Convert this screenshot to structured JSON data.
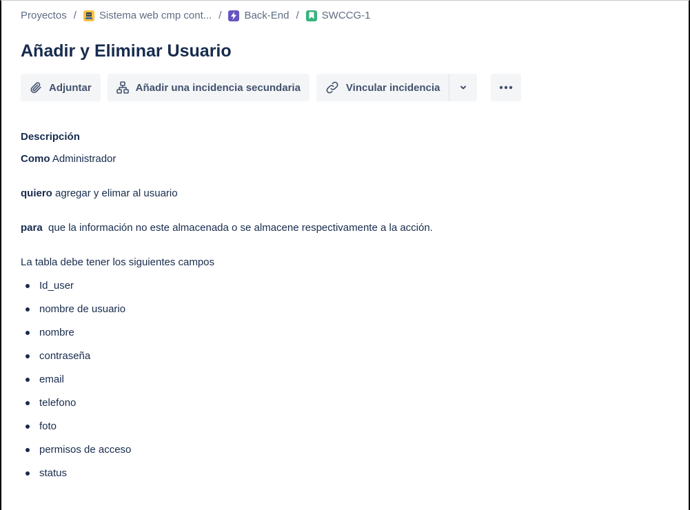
{
  "breadcrumb": {
    "projects": "Proyectos",
    "separator": "/",
    "project": "Sistema web cmp cont...",
    "epic": "Back-End",
    "issue_key": "SWCCG-1"
  },
  "issue": {
    "title": "Añadir y Eliminar Usuario"
  },
  "toolbar": {
    "attach": "Adjuntar",
    "add_child": "Añadir una incidencia secundaria",
    "link_issue": "Vincular incidencia",
    "icons": {
      "attach": "paperclip-icon",
      "add_child": "hierarchy-icon",
      "link_issue": "link-icon",
      "dropdown": "chevron-down-icon",
      "more": "more-icon"
    }
  },
  "description": {
    "heading": "Descripción",
    "as_label": "Como",
    "as_text": " Administrador",
    "want_label": "quiero",
    "want_text": " agregar y elimar al usuario",
    "so_label": "para",
    "so_text": "  que la información no este almacenada o se almacene respectivamente a la acción.",
    "table_intro": "La tabla debe tener los siguientes campos",
    "fields": [
      "Id_user",
      "nombre de usuario",
      "nombre",
      "contraseña",
      "email",
      "telefono",
      "foto",
      "permisos de acceso",
      "status"
    ]
  },
  "colors": {
    "project_icon": "#f6c342",
    "epic_icon": "#6554c0",
    "story_icon": "#36b37e",
    "text": "#172b4d",
    "subtle_text": "#5e6c84",
    "button_bg": "#f4f5f7"
  }
}
